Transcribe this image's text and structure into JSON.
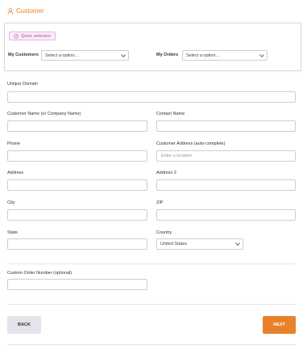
{
  "header": {
    "title": "Customer",
    "icon": "user-icon",
    "accent": "#e8822a"
  },
  "quick_selection": {
    "button_label": "Quick selection",
    "my_customers_label": "My Customers",
    "my_customers_value": "Select a option...",
    "my_orders_label": "My Orders",
    "my_orders_value": "Select a option..."
  },
  "form": {
    "unique_domain_label": "Unique Domain",
    "customer_name_label": "Customer Name (or Company Name)",
    "contact_name_label": "Contact Name",
    "phone_label": "Phone",
    "customer_address_label": "Customer Address (auto-complete)",
    "customer_address_placeholder": "Enter a location",
    "address_label": "Address",
    "address2_label": "Address 2",
    "city_label": "City",
    "zip_label": "ZIP",
    "state_label": "State",
    "country_label": "Country",
    "country_value": "United States",
    "custom_order_label": "Custom Order Number (optional)"
  },
  "actions": {
    "back_label": "BACK",
    "next_label": "NEXT"
  }
}
